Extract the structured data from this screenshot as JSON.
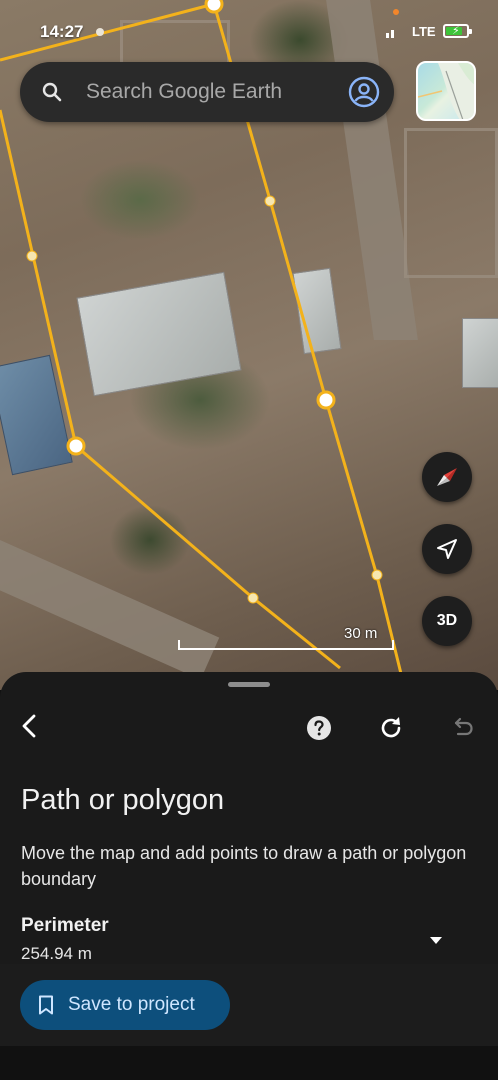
{
  "status_bar": {
    "time": "14:27",
    "network": "LTE"
  },
  "search": {
    "placeholder": "Search Google Earth"
  },
  "map": {
    "scale_label": "30 m",
    "view_mode_label": "3D"
  },
  "panel": {
    "title": "Path or polygon",
    "description": "Move the map and add points to draw a path or polygon boundary",
    "perimeter_label": "Perimeter",
    "perimeter_value": "254.94 m",
    "save_label": "Save to project"
  },
  "colors": {
    "polygon_outline": "#f3b21b",
    "save_button": "#0d4f7c",
    "panel_bg": "#1a1a1a"
  },
  "icons": [
    "search-icon",
    "account-icon",
    "compass-icon",
    "my-location-icon",
    "back-icon",
    "help-icon",
    "redo-icon",
    "undo-icon",
    "chevron-down-icon",
    "bookmark-icon"
  ]
}
